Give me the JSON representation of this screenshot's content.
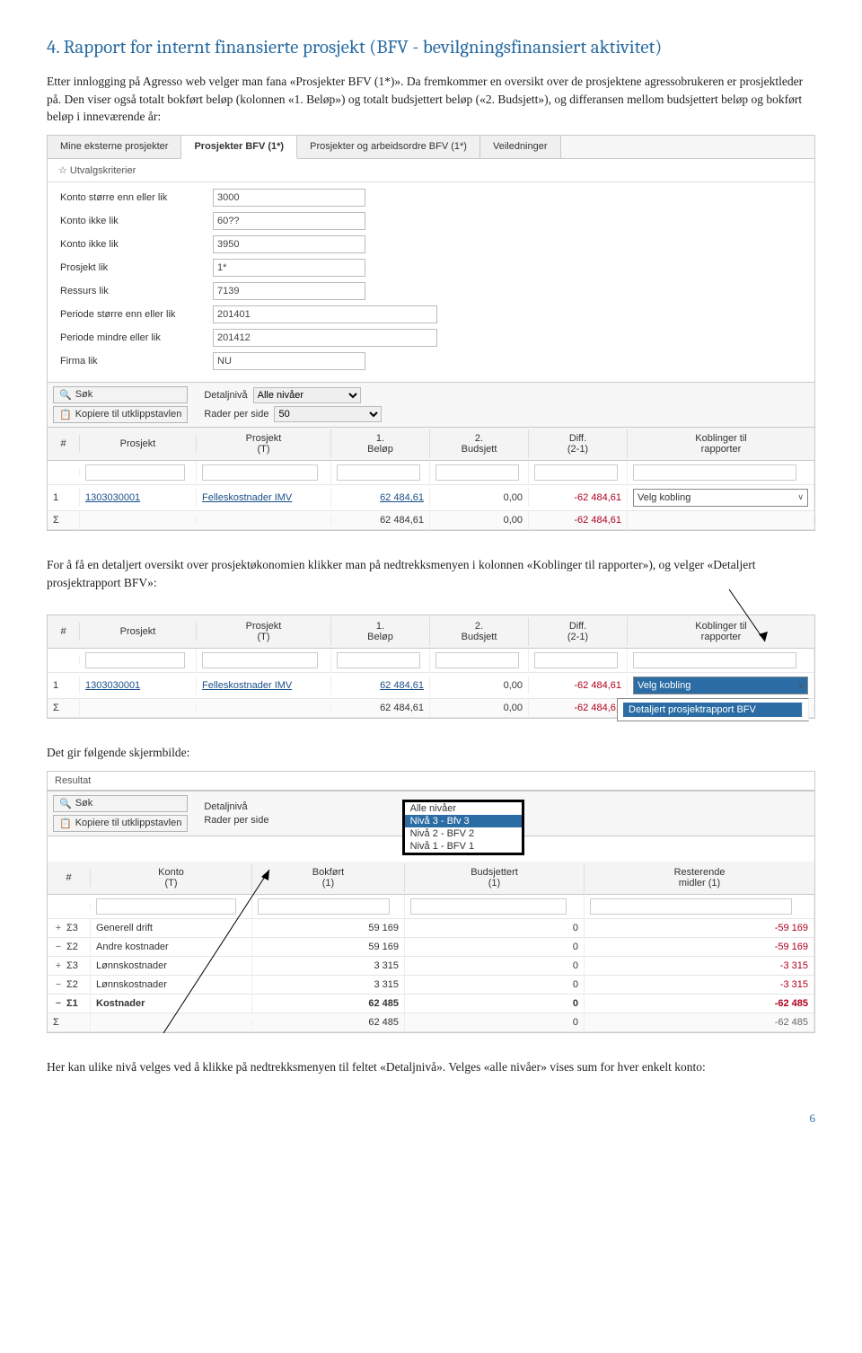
{
  "heading": "4. Rapport for internt finansierte prosjekt (BFV - bevilgningsfinansiert aktivitet)",
  "para1": "Etter innlogging på Agresso web velger man fana «Prosjekter BFV (1*)». Da fremkommer en oversikt over de prosjektene agressobrukeren er prosjektleder på. Den viser også totalt bokført beløp (kolonnen «1. Beløp») og totalt budsjettert beløp («2. Budsjett»), og differansen mellom budsjettert beløp og bokført beløp i inneværende år:",
  "tabs": {
    "t1": "Mine eksterne prosjekter",
    "t2": "Prosjekter BFV (1*)",
    "t3": "Prosjekter og arbeidsordre BFV (1*)",
    "t4": "Veiledninger"
  },
  "criteria": {
    "head": "☆ Utvalgskriterier",
    "rows": [
      {
        "lbl": "Konto større enn eller lik",
        "val": "3000"
      },
      {
        "lbl": "Konto ikke lik",
        "val": "60??"
      },
      {
        "lbl": "Konto ikke lik",
        "val": "3950"
      },
      {
        "lbl": "Prosjekt lik",
        "val": "1*"
      },
      {
        "lbl": "Ressurs lik",
        "val": "7139"
      },
      {
        "lbl": "Periode større enn eller lik",
        "val": "201401"
      },
      {
        "lbl": "Periode mindre eller lik",
        "val": "201412"
      },
      {
        "lbl": "Firma lik",
        "val": "NU"
      }
    ]
  },
  "toolbar": {
    "sok": "Søk",
    "kopier": "Kopiere til utklippstavlen",
    "detalj": "Detaljnivå",
    "detalj_val": "Alle nivåer",
    "rader": "Rader per side",
    "rader_val": "50"
  },
  "grid": {
    "head": {
      "h0": "#",
      "h1": "Prosjekt",
      "h2": "Prosjekt\n(T)",
      "h3": "1.\nBeløp",
      "h4": "2.\nBudsjett",
      "h5": "Diff.\n(2-1)",
      "h6": "Koblinger til\nrapporter"
    },
    "row1": {
      "n": "1",
      "prosj": "1303030001",
      "t": "Felleskostnader IMV",
      "belop": "62 484,61",
      "bud": "0,00",
      "diff": "-62 484,61",
      "velg": "Velg kobling"
    },
    "sum": {
      "s": "Σ",
      "belop": "62 484,61",
      "bud": "0,00",
      "diff": "-62 484,61"
    },
    "dropdown_opt": "Detaljert prosjektrapport BFV"
  },
  "para2": "For å få en detaljert oversikt over prosjektøkonomien klikker man på nedtrekksmenyen i kolonnen «Koblinger til rapporter»), og velger «Detaljert prosjektrapport BFV»:",
  "para3": "Det gir følgende skjermbilde:",
  "result": {
    "head_label": "Resultat",
    "head": {
      "h0": "#",
      "h1": "Konto\n(T)",
      "h2": "Bokført\n(1)",
      "h3": "Budsjettert\n(1)",
      "h4": "Resterende\nmidler (1)"
    },
    "rows": [
      {
        "exp": "+",
        "lvl": "Σ3",
        "t": "Generell drift",
        "b": "59 169",
        "bu": "0",
        "r": "-59 169"
      },
      {
        "exp": "−",
        "lvl": "Σ2",
        "t": "Andre kostnader",
        "b": "59 169",
        "bu": "0",
        "r": "-59 169"
      },
      {
        "exp": "+",
        "lvl": "Σ3",
        "t": "Lønnskostnader",
        "b": "3 315",
        "bu": "0",
        "r": "-3 315"
      },
      {
        "exp": "−",
        "lvl": "Σ2",
        "t": "Lønnskostnader",
        "b": "3 315",
        "bu": "0",
        "r": "-3 315"
      },
      {
        "exp": "−",
        "lvl": "Σ1",
        "t": "Kostnader",
        "b": "62 485",
        "bu": "0",
        "r": "-62 485",
        "bold": true
      }
    ],
    "sum": {
      "s": "Σ",
      "b": "62 485",
      "bu": "0",
      "r": "-62 485"
    },
    "popup": [
      "Alle nivåer",
      "Nivå 3 - Bfv 3",
      "Nivå 2 - BFV 2",
      "Nivå 1 - BFV 1"
    ]
  },
  "para4": "Her kan ulike nivå velges ved å klikke på nedtrekksmenyen til feltet «Detaljnivå». Velges «alle nivåer» vises sum for hver enkelt konto:",
  "page": "6"
}
